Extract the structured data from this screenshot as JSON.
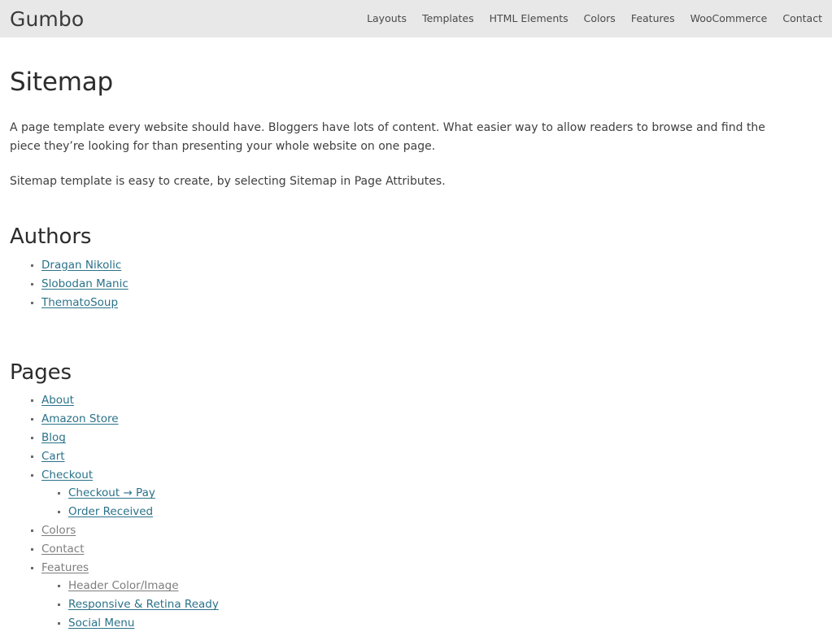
{
  "header": {
    "site_title": "Gumbo",
    "nav_items": [
      {
        "label": "Layouts"
      },
      {
        "label": "Templates"
      },
      {
        "label": "HTML Elements"
      },
      {
        "label": "Colors"
      },
      {
        "label": "Features"
      },
      {
        "label": "WooCommerce"
      },
      {
        "label": "Contact"
      }
    ]
  },
  "main": {
    "page_title": "Sitemap",
    "paragraphs": [
      "A page template every website should have. Bloggers have lots of content. What easier way to allow readers to browse and find the piece they’re looking for than presenting your whole website on one page.",
      "Sitemap template is easy to create, by selecting Sitemap in Page Attributes."
    ],
    "sections": [
      {
        "heading": "Authors",
        "items": [
          {
            "label": "Dragan Nikolic",
            "state": "unvisited"
          },
          {
            "label": "Slobodan Manic",
            "state": "unvisited"
          },
          {
            "label": "ThematoSoup",
            "state": "unvisited"
          }
        ]
      },
      {
        "heading": "Pages",
        "items": [
          {
            "label": "About",
            "state": "unvisited"
          },
          {
            "label": "Amazon Store",
            "state": "unvisited"
          },
          {
            "label": "Blog",
            "state": "unvisited"
          },
          {
            "label": "Cart",
            "state": "unvisited"
          },
          {
            "label": "Checkout",
            "state": "unvisited",
            "children": [
              {
                "label": "Checkout → Pay",
                "state": "unvisited"
              },
              {
                "label": "Order Received",
                "state": "unvisited"
              }
            ]
          },
          {
            "label": "Colors",
            "state": "visited"
          },
          {
            "label": "Contact",
            "state": "visited"
          },
          {
            "label": "Features",
            "state": "visited",
            "children": [
              {
                "label": "Header Color/Image",
                "state": "visited"
              },
              {
                "label": "Responsive & Retina Ready",
                "state": "unvisited"
              },
              {
                "label": "Social Menu",
                "state": "unvisited"
              }
            ]
          }
        ]
      }
    ]
  },
  "colors": {
    "header_background": "#e8e8e8",
    "link": "#2a7289",
    "link_visited": "#7d7d7d",
    "heading": "#2c2c2c",
    "body_text": "#3f3f3f",
    "page_background": "#ffffff"
  }
}
